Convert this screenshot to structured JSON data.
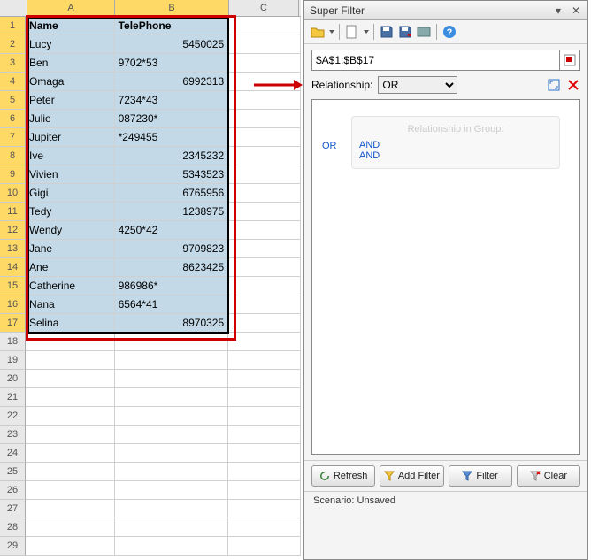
{
  "panel": {
    "title": "Super Filter",
    "range": "$A$1:$B$17",
    "rel_label": "Relationship:",
    "rel_value": "OR",
    "group_title": "Relationship in Group:",
    "or_link": "OR",
    "and_links": [
      "AND",
      "AND"
    ],
    "buttons": {
      "refresh": "Refresh",
      "add": "Add Filter",
      "filter": "Filter",
      "clear": "Clear"
    },
    "scenario_label": "Scenario:",
    "scenario_value": "Unsaved"
  },
  "columns": [
    "A",
    "B",
    "C"
  ],
  "headers": {
    "name": "Name",
    "phone": "TelePhone"
  },
  "rows": [
    {
      "n": "Lucy",
      "p": "5450025",
      "num": true
    },
    {
      "n": "Ben",
      "p": "9702*53",
      "num": false
    },
    {
      "n": "Omaga",
      "p": "6992313",
      "num": true
    },
    {
      "n": "Peter",
      "p": "7234*43",
      "num": false
    },
    {
      "n": "Julie",
      "p": "087230*",
      "num": false
    },
    {
      "n": "Jupiter",
      "p": "*249455",
      "num": false
    },
    {
      "n": "Ive",
      "p": "2345232",
      "num": true
    },
    {
      "n": "Vivien",
      "p": "5343523",
      "num": true
    },
    {
      "n": "Gigi",
      "p": "6765956",
      "num": true
    },
    {
      "n": "Tedy",
      "p": "1238975",
      "num": true
    },
    {
      "n": "Wendy",
      "p": "4250*42",
      "num": false
    },
    {
      "n": "Jane",
      "p": "9709823",
      "num": true
    },
    {
      "n": "Ane",
      "p": "8623425",
      "num": true
    },
    {
      "n": "Catherine",
      "p": "986986*",
      "num": false
    },
    {
      "n": "Nana",
      "p": "6564*41",
      "num": false
    },
    {
      "n": "Selina",
      "p": "8970325",
      "num": true
    }
  ],
  "emptyRows": 12
}
